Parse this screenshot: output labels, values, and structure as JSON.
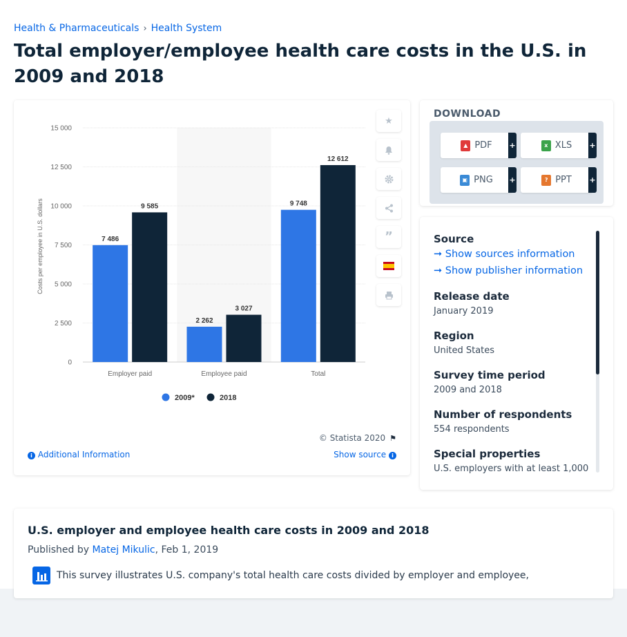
{
  "breadcrumb": {
    "items": [
      "Health & Pharmaceuticals",
      "Health System"
    ],
    "separator": "›"
  },
  "page_title": "Total employer/employee health care costs in the U.S. in 2009 and 2018",
  "chart_data": {
    "type": "bar",
    "categories": [
      "Employer paid",
      "Employee paid",
      "Total"
    ],
    "series": [
      {
        "name": "2009*",
        "values": [
          7486,
          2262,
          9748
        ],
        "labels": [
          "7 486",
          "2 262",
          "9 748"
        ],
        "color": "#2e76e5"
      },
      {
        "name": "2018",
        "values": [
          9585,
          3027,
          12612
        ],
        "labels": [
          "9 585",
          "3 027",
          "12 612"
        ],
        "color": "#0f2538"
      }
    ],
    "ylabel": "Costs per employee in U.S. dollars",
    "ylim": [
      0,
      15000
    ],
    "yticks": [
      0,
      2500,
      5000,
      7500,
      10000,
      12500,
      15000
    ],
    "ytick_labels": [
      "0",
      "2 500",
      "5 000",
      "7 500",
      "10 000",
      "12 500",
      "15 000"
    ],
    "highlighted_category": "Employee paid",
    "legend_position": "bottom-center",
    "grid": true
  },
  "chart_footer": {
    "copyright": "© Statista 2020",
    "additional_info": "Additional Information",
    "show_source": "Show source"
  },
  "tools": [
    "star-icon",
    "bell-icon",
    "gear-icon",
    "share-icon",
    "quote-icon",
    "flag-spain-icon",
    "print-icon"
  ],
  "download": {
    "title": "DOWNLOAD",
    "buttons": [
      {
        "label": "PDF",
        "color": "#e03a3a"
      },
      {
        "label": "XLS",
        "color": "#3aa34a"
      },
      {
        "label": "PNG",
        "color": "#3a8ad6"
      },
      {
        "label": "PPT",
        "color": "#e5772e"
      }
    ],
    "plus": "+"
  },
  "source": {
    "heading": "Source",
    "links": [
      "Show sources information",
      "Show publisher information"
    ],
    "fields": [
      {
        "label": "Release date",
        "value": "January 2019"
      },
      {
        "label": "Region",
        "value": "United States"
      },
      {
        "label": "Survey time period",
        "value": "2009 and 2018"
      },
      {
        "label": "Number of respondents",
        "value": "554 respondents"
      },
      {
        "label": "Special properties",
        "value": "U.S. employers with at least 1,000"
      }
    ]
  },
  "description": {
    "title": "U.S. employer and employee health care costs in 2009 and 2018",
    "published_by": "Published by",
    "author": "Matej Mikulic",
    "date": ", Feb 1, 2019",
    "text": "This survey illustrates U.S. company's total health care costs divided by employer and employee,"
  }
}
